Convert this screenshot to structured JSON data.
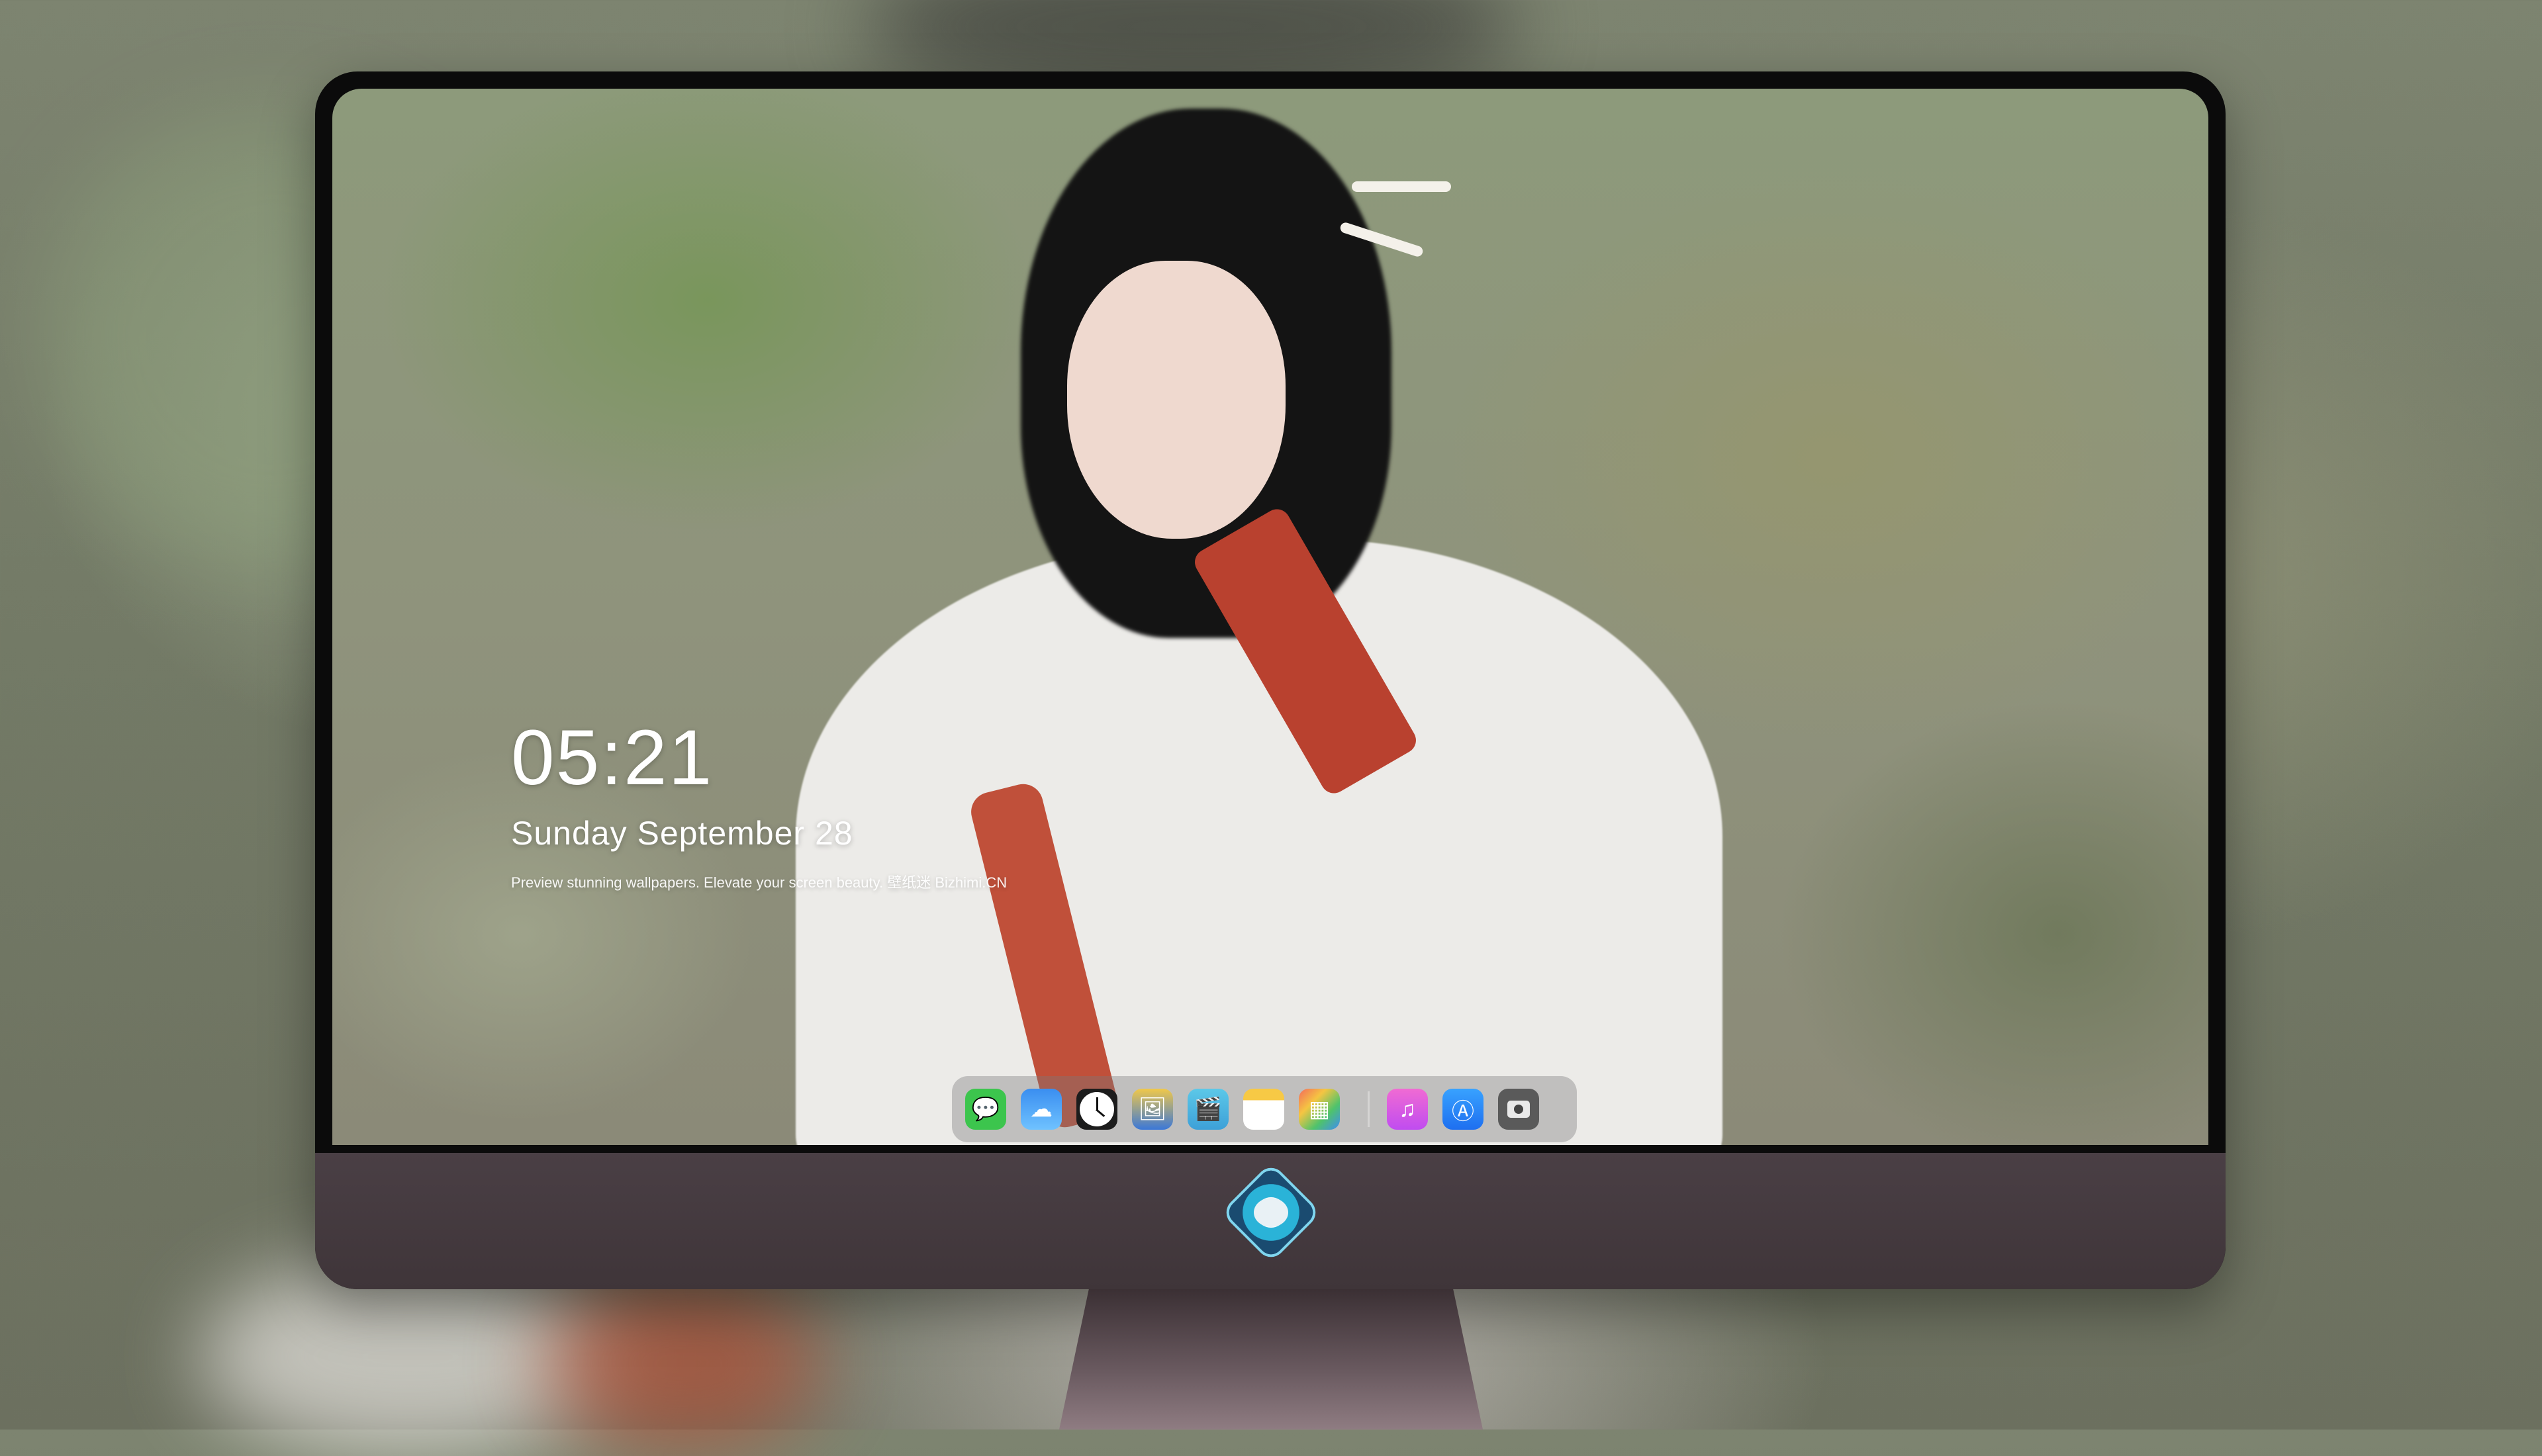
{
  "lockscreen": {
    "time": "05:21",
    "date": "Sunday September  28",
    "tagline": "Preview stunning wallpapers. Elevate your screen beauty. 壁纸迷 Bizhimi.CN"
  },
  "dock": {
    "apps": [
      {
        "name": "Messages",
        "icon": "messages-icon"
      },
      {
        "name": "Weather",
        "icon": "weather-icon"
      },
      {
        "name": "Clock",
        "icon": "clock-icon"
      },
      {
        "name": "Preview",
        "icon": "preview-icon"
      },
      {
        "name": "Clips",
        "icon": "clapperboard-icon"
      },
      {
        "name": "Notes",
        "icon": "notes-icon"
      },
      {
        "name": "Photos",
        "icon": "photos-icon"
      },
      {
        "name": "Music",
        "icon": "music-note-icon"
      },
      {
        "name": "App Store",
        "icon": "app-store-icon"
      },
      {
        "name": "Camera",
        "icon": "camera-icon"
      }
    ],
    "glyphs": {
      "messages": "💬",
      "weather": "☁",
      "preview": "🖼",
      "clips": "🎬",
      "photos": "▦",
      "music": "♫",
      "appstore": "Ⓐ"
    }
  },
  "colors": {
    "monitor_bezel": "#0b0b0b",
    "chin": "#4a3f45",
    "stand": "#6b5b61"
  }
}
